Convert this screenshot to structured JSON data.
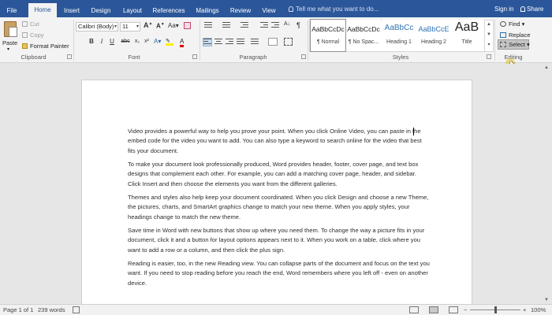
{
  "tabs": [
    "File",
    "Home",
    "Insert",
    "Design",
    "Layout",
    "References",
    "Mailings",
    "Review",
    "View"
  ],
  "active_tab": "Home",
  "tell_me": "Tell me what you want to do...",
  "account": {
    "sign_in": "Sign in",
    "share": "Share"
  },
  "clipboard": {
    "paste": "Paste",
    "cut": "Cut",
    "copy": "Copy",
    "format_painter": "Format Painter",
    "label": "Clipboard"
  },
  "font": {
    "name": "Calibri (Body)",
    "size": "11",
    "label": "Font",
    "bold": "B",
    "italic": "I",
    "underline": "U",
    "strike": "abc",
    "sub": "x₂",
    "sup": "x²"
  },
  "paragraph": {
    "label": "Paragraph",
    "pilcrow": "¶"
  },
  "styles": {
    "label": "Styles",
    "items": [
      {
        "sample": "AaBbCcDc",
        "name": "¶ Normal"
      },
      {
        "sample": "AaBbCcDc",
        "name": "¶ No Spac..."
      },
      {
        "sample": "AaBbCc",
        "name": "Heading 1"
      },
      {
        "sample": "AaBbCcE",
        "name": "Heading 2"
      },
      {
        "sample": "AaB",
        "name": "Title"
      }
    ]
  },
  "editing": {
    "find": "Find",
    "replace": "Replace",
    "select": "Select",
    "label": "Editing"
  },
  "document": {
    "paragraphs": [
      "Video provides a powerful way to help you prove your point. When you click Online Video, you can paste in the embed code for the video you want to add. You can also type a keyword to search online for the video that best fits your document.",
      "To make your document look professionally produced, Word provides header, footer, cover page, and text box designs that complement each other. For example, you can add a matching cover page, header, and sidebar. Click Insert and then choose the elements you want from the different galleries.",
      "Themes and styles also help keep your document coordinated. When you click Design and choose a new Theme, the pictures, charts, and SmartArt graphics change to match your new theme. When you apply styles, your headings change to match the new theme.",
      "Save time in Word with new buttons that show up where you need them. To change the way a picture fits in your document, click it and a button for layout options appears next to it. When you work on a table, click where you want to add a row or a column, and then click the plus sign.",
      "Reading is easier, too, in the new Reading view. You can collapse parts of the document and focus on the text you want. If you need to stop reading before you reach the end, Word remembers where you left off - even on another device."
    ]
  },
  "status": {
    "page": "Page 1 of 1",
    "words": "239 words",
    "zoom": "100%",
    "zoom_minus": "−",
    "zoom_plus": "+"
  },
  "colors": {
    "brand": "#2b579a",
    "ribbon": "#f3f3f3",
    "canvas": "#e6e6e6"
  }
}
